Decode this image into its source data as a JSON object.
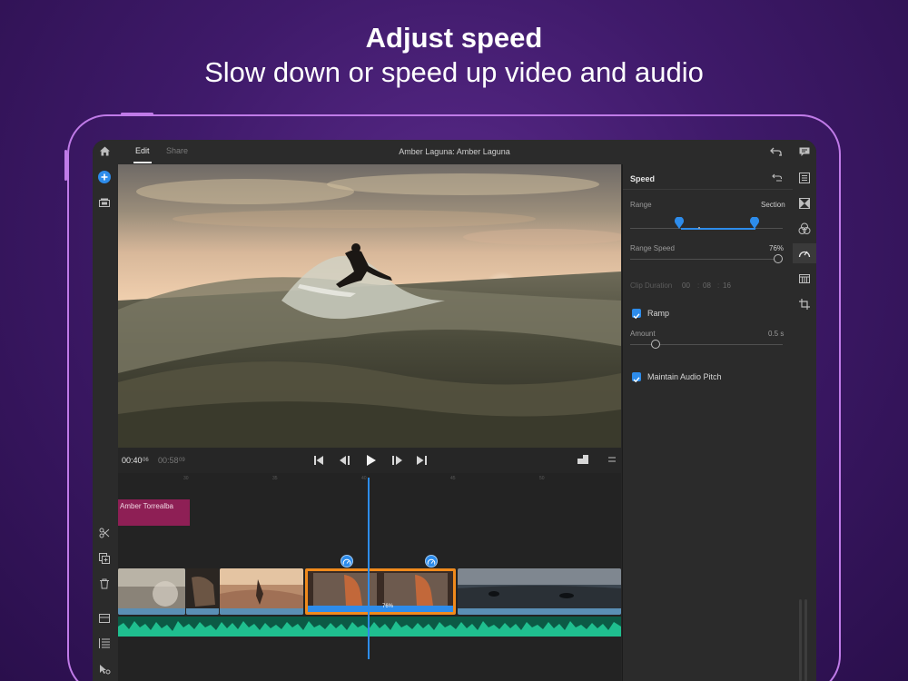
{
  "hero": {
    "title": "Adjust speed",
    "subtitle": "Slow down or speed up video and audio"
  },
  "topbar": {
    "tabs": [
      {
        "label": "Edit",
        "active": true
      },
      {
        "label": "Share",
        "active": false
      }
    ],
    "project_title": "Amber Laguna: Amber Laguna",
    "icons": [
      "home-icon",
      "undo-icon"
    ]
  },
  "left_toolbar": {
    "icons": [
      "add-icon",
      "media-icon",
      "split-icon",
      "duplicate-icon",
      "delete-icon",
      "track-icon",
      "list-icon",
      "select-tool-icon"
    ]
  },
  "right_toolbar": {
    "icons": [
      "feedback-icon",
      "properties-icon",
      "transitions-icon",
      "color-icon",
      "speed-icon",
      "effects-icon",
      "crop-icon"
    ]
  },
  "speed_panel": {
    "title": "Speed",
    "range_label": "Range",
    "range_value": "Section",
    "range_speed_label": "Range Speed",
    "range_speed_value": "76%",
    "range_speed_fraction": 0.76,
    "clip_duration_label": "Clip Duration",
    "clip_duration": {
      "h": "00",
      "m": "08",
      "s": "16"
    },
    "ramp_label": "Ramp",
    "ramp_checked": true,
    "amount_label": "Amount",
    "amount_value": "0.5 s",
    "maintain_pitch_label": "Maintain Audio Pitch",
    "maintain_pitch_checked": true
  },
  "transport": {
    "current_time": "00:40",
    "current_frames": "06",
    "total_time": "00:58",
    "total_frames": "09"
  },
  "timeline": {
    "ruler_labels": [
      "30",
      "35",
      "40",
      "45",
      "50"
    ],
    "title_clip": "Amber Torrealba",
    "selected_clip_speed": "76%"
  },
  "colors": {
    "accent": "#2d8ceb",
    "selection": "#f08a1c",
    "title_clip": "#8e1f55",
    "audio": "#1fbf8f",
    "frame": "#c07be8"
  }
}
